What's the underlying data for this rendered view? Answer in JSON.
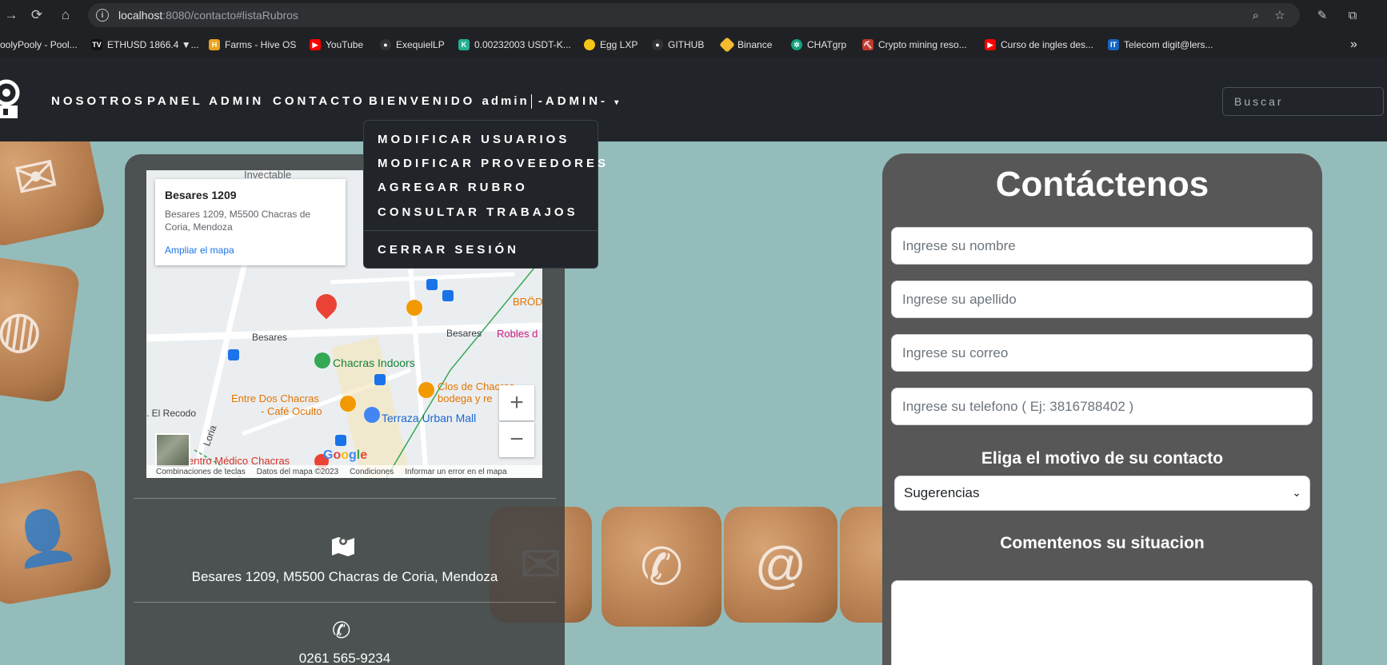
{
  "browser": {
    "url_host": "localhost",
    "url_rest": ":8080/contacto#listaRubros",
    "bookmarks": [
      {
        "label": "oolyPooly - Pool...",
        "icon": "pool-icon",
        "color": "#444"
      },
      {
        "label": "ETHUSD 1866.4 ▼...",
        "icon": "tradingview-icon",
        "color": "#111"
      },
      {
        "label": "Farms - Hive OS",
        "icon": "hive-icon",
        "color": "#e8a21b"
      },
      {
        "label": "YouTube",
        "icon": "youtube-icon",
        "color": "#ff0000"
      },
      {
        "label": "ExequielLP",
        "icon": "github-icon",
        "color": "#333"
      },
      {
        "label": "0.00232003 USDT-K...",
        "icon": "kucoin-icon",
        "color": "#23af91"
      },
      {
        "label": "Egg LXP",
        "icon": "egg-icon",
        "color": "#f5c518"
      },
      {
        "label": "GITHUB",
        "icon": "github-icon",
        "color": "#333"
      },
      {
        "label": "Binance",
        "icon": "binance-icon",
        "color": "#f3ba2f"
      },
      {
        "label": "CHATgrp",
        "icon": "chatgpt-icon",
        "color": "#10a37f"
      },
      {
        "label": "Crypto mining reso...",
        "icon": "mining-icon",
        "color": "#c0392b"
      },
      {
        "label": "Curso de ingles des...",
        "icon": "youtube-icon",
        "color": "#ff0000"
      },
      {
        "label": "Telecom digit@lers...",
        "icon": "telecom-icon",
        "color": "#1565c0"
      }
    ]
  },
  "navbar": {
    "links": [
      "NOSOTROS",
      "PANEL ADMIN",
      "CONTACTO"
    ],
    "welcome": "BIENVENIDO",
    "username": "admin",
    "role": "-ADMIN-",
    "search_placeholder": "Buscar"
  },
  "dropdown": {
    "items": [
      "MODIFICAR USUARIOS",
      "MODIFICAR PROVEEDORES",
      "AGREGAR RUBRO",
      "CONSULTAR TRABAJOS"
    ],
    "logout": "CERRAR SESIÓN"
  },
  "map": {
    "place_title": "Besares 1209",
    "place_address": "Besares 1209, M5500 Chacras de Coria, Mendoza",
    "enlarge_link": "Ampliar el mapa",
    "labels": {
      "invectable": "Invectable",
      "brod": "BRÖD",
      "street_1": "Besares",
      "street_2": "Besares",
      "robles": "Robles d",
      "chacras_indoors": "Chacras Indoors",
      "entre_dos": "Entre Dos Chacras",
      "cafe_oculto": "- Café Oculto",
      "clos_de_chacras": "Clos de Chacras",
      "bodega": "bodega y re",
      "el_recodo": ". El Recodo",
      "loria": "Loria",
      "terraza": "Terraza Urban Mall",
      "centro_medico": "entro Médico Chacras"
    },
    "google": "Google",
    "footer": [
      "Combinaciones de teclas",
      "Datos del mapa ©2023",
      "Condiciones",
      "Informar un error en el mapa"
    ]
  },
  "info": {
    "address": "Besares 1209, M5500 Chacras de Coria, Mendoza",
    "phone": "0261 565-9234"
  },
  "contact": {
    "title": "Contáctenos",
    "name_placeholder": "Ingrese su nombre",
    "lastname_placeholder": "Ingrese su apellido",
    "email_placeholder": "Ingrese su correo",
    "phone_placeholder": "Ingrese su telefono ( Ej: 3816788402 )",
    "reason_label": "Eliga el motivo de su contacto",
    "reason_value": "Sugerencias",
    "comment_label": "Comentenos su situacion"
  }
}
